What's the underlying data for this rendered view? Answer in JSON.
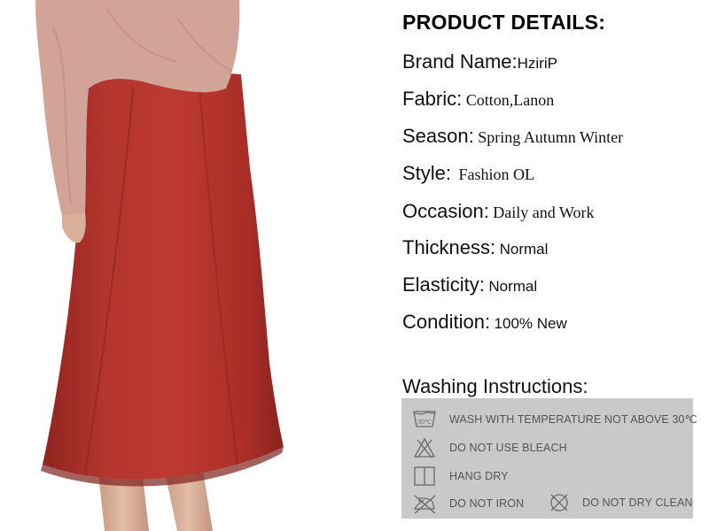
{
  "details": {
    "title": "PRODUCT DETAILS:",
    "rows": [
      {
        "key": "Brand Name:",
        "value": "HziriP"
      },
      {
        "key": "Fabric:",
        "value": "Cotton,Lanon"
      },
      {
        "key": "Season:",
        "value": "Spring Autumn Winter"
      },
      {
        "key": "Style:",
        "value": "Fashion OL"
      },
      {
        "key": "Occasion:",
        "value": "Daily and Work"
      },
      {
        "key": "Thickness:",
        "value": "Normal"
      },
      {
        "key": "Elasticity:",
        "value": "Normal"
      },
      {
        "key": "Condition:",
        "value": "100% New"
      }
    ]
  },
  "washing": {
    "title": "Washing Instructions:",
    "temp_icon_text": "30℃",
    "items": [
      {
        "icon": "wash-30-icon",
        "label": "WASH WITH TEMPERATURE NOT ABOVE 30℃"
      },
      {
        "icon": "no-bleach-icon",
        "label": "DO NOT USE BLEACH"
      },
      {
        "icon": "hang-dry-icon",
        "label": "HANG DRY"
      },
      {
        "icon": "do-not-iron-icon",
        "label": "DO NOT IRON"
      },
      {
        "icon": "do-not-dry-clean-icon",
        "label": "DO NOT DRY CLEAN"
      }
    ]
  },
  "colors": {
    "skirt": "#b1332d",
    "sweater": "#d4a89c",
    "wash_box_bg": "#c9c9c9"
  }
}
